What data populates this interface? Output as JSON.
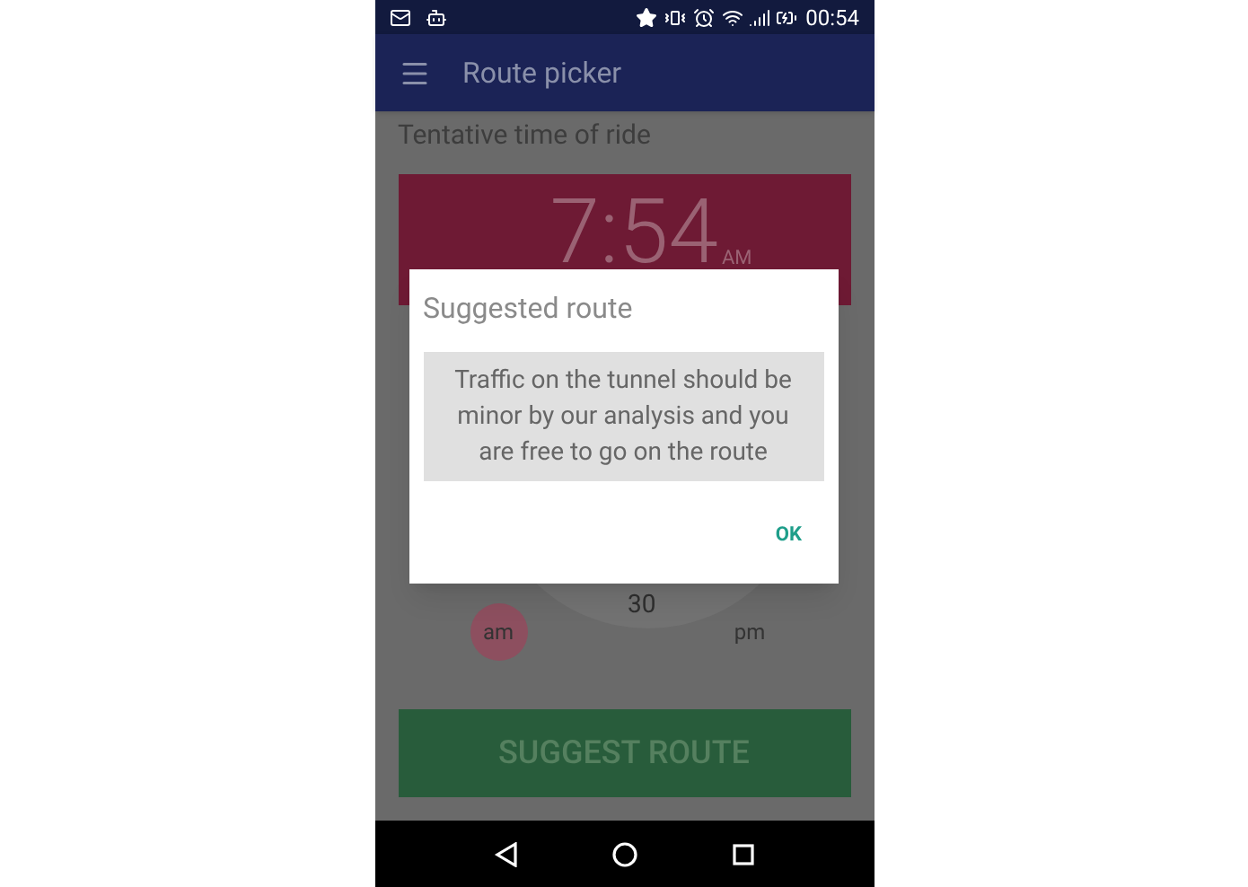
{
  "status_bar": {
    "time": "00:54"
  },
  "app_bar": {
    "title": "Route picker"
  },
  "time_label": "Tentative time of ride",
  "time_display": {
    "time": "7:54",
    "period": "AM"
  },
  "clock_numbers": [
    "30"
  ],
  "period_options": [
    {
      "label": "am",
      "selected": true
    },
    {
      "label": "pm",
      "selected": false
    }
  ],
  "suggest_button": "SUGGEST ROUTE",
  "dialog": {
    "title": "Suggested route",
    "message": "Traffic on the tunnel should be minor by our analysis and you are free to go on the route",
    "button": "OK"
  }
}
